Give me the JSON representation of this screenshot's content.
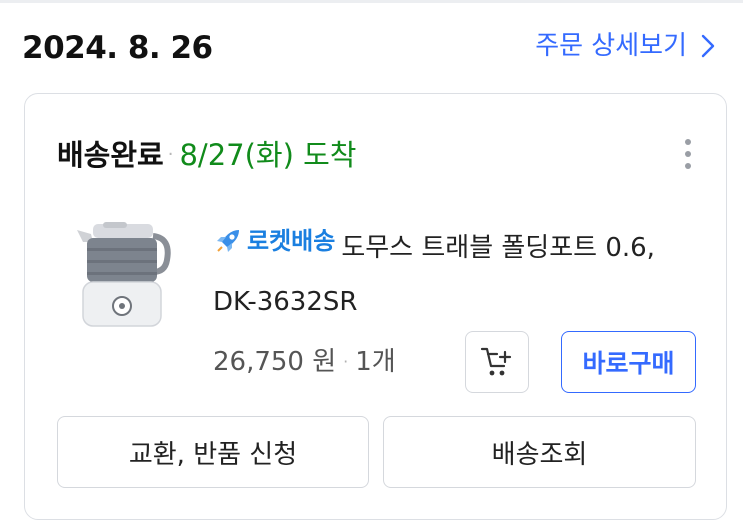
{
  "order": {
    "date": "2024. 8. 26",
    "detail_link": "주문 상세보기"
  },
  "shipment": {
    "status": "배송완료",
    "arrival": "8/27(화) 도착"
  },
  "product": {
    "badge": "로켓배송",
    "name": "도무스 트래블 폴딩포트 0.6, DK-3632SR",
    "price": "26,750 원",
    "quantity": "1개",
    "image_icon": "folding-kettle-image"
  },
  "actions": {
    "cart_icon": "add-to-cart-icon",
    "buy_now": "바로구매",
    "exchange_return": "교환, 반품 신청",
    "track_delivery": "배송조회"
  },
  "colors": {
    "accent": "#346aff",
    "arrival_green": "#118b1b",
    "rocket_blue": "#1a7fe0"
  }
}
